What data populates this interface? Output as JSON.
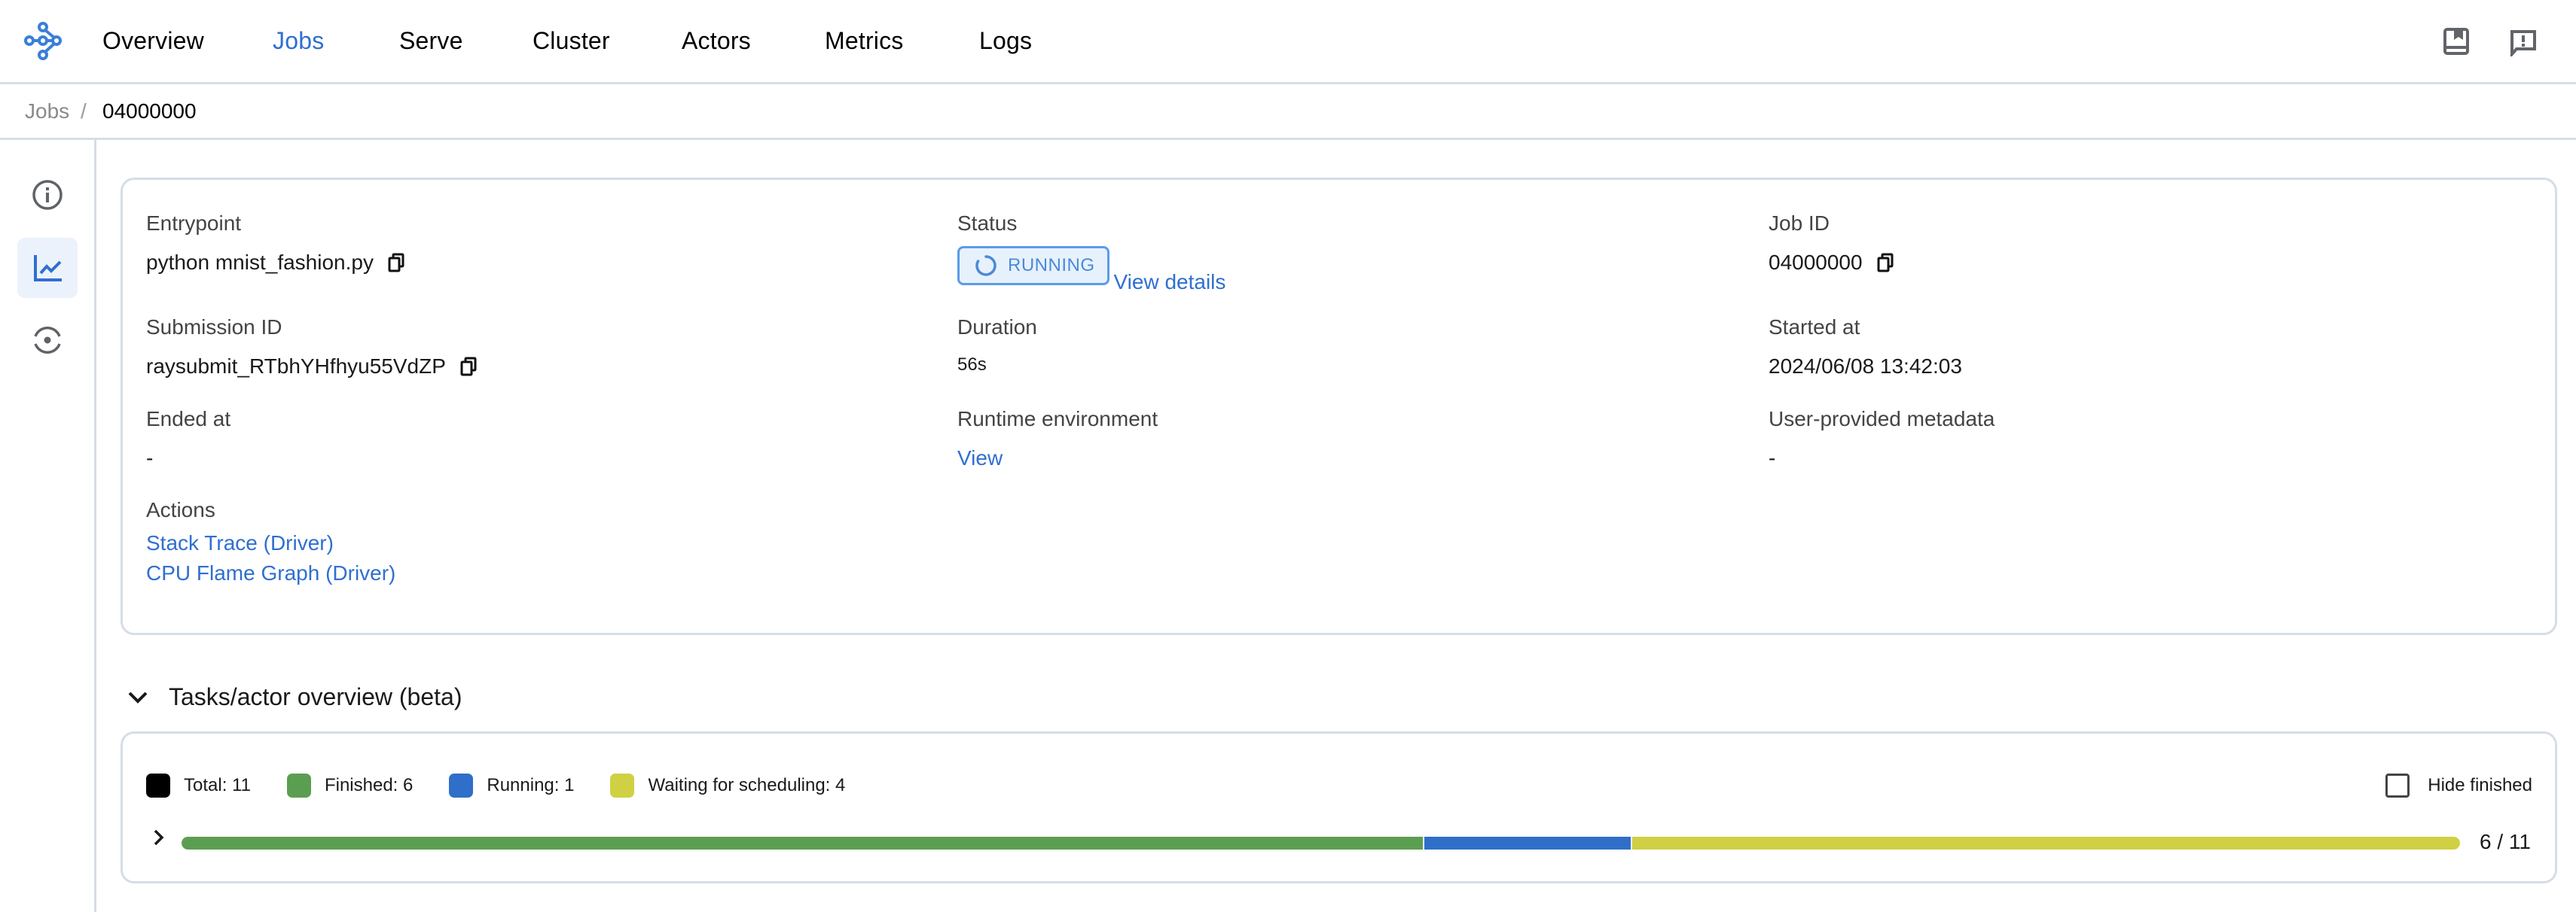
{
  "nav": {
    "items": [
      {
        "label": "Overview",
        "active": false
      },
      {
        "label": "Jobs",
        "active": true
      },
      {
        "label": "Serve",
        "active": false
      },
      {
        "label": "Cluster",
        "active": false
      },
      {
        "label": "Actors",
        "active": false
      },
      {
        "label": "Metrics",
        "active": false
      },
      {
        "label": "Logs",
        "active": false
      }
    ],
    "right_icons": [
      "docs-book-icon",
      "feedback-icon"
    ]
  },
  "breadcrumb": {
    "parent": "Jobs",
    "separator": "/",
    "current": "04000000"
  },
  "sidebar": {
    "items": [
      {
        "icon": "info-icon",
        "active": false
      },
      {
        "icon": "chart-icon",
        "active": true
      },
      {
        "icon": "target-icon",
        "active": false
      }
    ]
  },
  "job": {
    "entrypoint": {
      "label": "Entrypoint",
      "value": "python mnist_fashion.py"
    },
    "status": {
      "label": "Status",
      "value": "RUNNING",
      "details_link": "View details"
    },
    "job_id": {
      "label": "Job ID",
      "value": "04000000"
    },
    "submission_id": {
      "label": "Submission ID",
      "value": "raysubmit_RTbhYHfhyu55VdZP"
    },
    "duration": {
      "label": "Duration",
      "value": "56s"
    },
    "started_at": {
      "label": "Started at",
      "value": "2024/06/08 13:42:03"
    },
    "ended_at": {
      "label": "Ended at",
      "value": "-"
    },
    "runtime_env": {
      "label": "Runtime environment",
      "value": "View"
    },
    "metadata": {
      "label": "User-provided metadata",
      "value": "-"
    },
    "actions": {
      "label": "Actions",
      "links": [
        "Stack Trace (Driver)",
        "CPU Flame Graph (Driver)"
      ]
    }
  },
  "tasks_overview": {
    "title": "Tasks/actor overview (beta)",
    "legend": [
      {
        "label": "Total: 11",
        "color": "#000000"
      },
      {
        "label": "Finished: 6",
        "color": "#5c9e51"
      },
      {
        "label": "Running: 1",
        "color": "#2f6ec9"
      },
      {
        "label": "Waiting for scheduling: 4",
        "color": "#cfd044"
      }
    ],
    "hide_finished_label": "Hide finished",
    "hide_finished_checked": false,
    "progress": {
      "total": 11,
      "segments": [
        {
          "name": "finished",
          "count": 6,
          "color": "#5c9e51"
        },
        {
          "name": "running",
          "count": 1,
          "color": "#2f6ec9"
        },
        {
          "name": "waiting",
          "count": 4,
          "color": "#cfd044"
        }
      ],
      "count_label": "6 / 11"
    }
  },
  "colors": {
    "accent": "#2f6fd0",
    "border": "#d5dde7"
  }
}
